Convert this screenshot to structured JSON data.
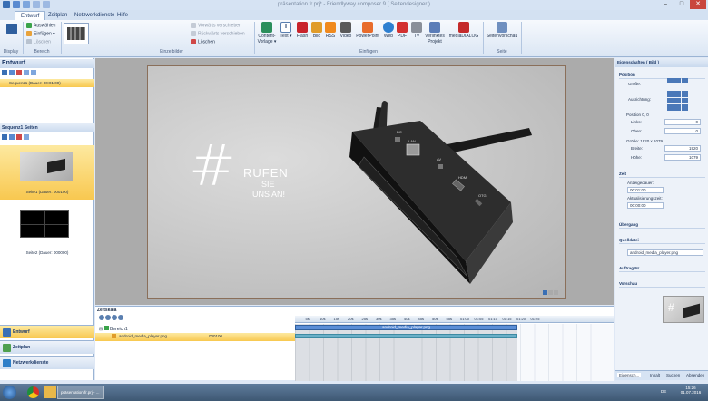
{
  "window": {
    "title": "präsentation.fr.prj* - Friendlyway composer 9 ( Seitendesigner )"
  },
  "tabs": [
    "Entwurf",
    "Zeitplan",
    "Netzwerkdienste",
    "Hilfe"
  ],
  "ribbon": {
    "display_label": "Display",
    "bereich": {
      "items": [
        "Auswählen",
        "Einfügen",
        "Löschen"
      ],
      "label": "Bereich"
    },
    "einzelbilder": {
      "items": [
        "Vorwärts verschieben",
        "Rückwärts verschieben",
        "Löschen"
      ],
      "label": "Einzelbilder"
    },
    "einfuegen": {
      "buttons": [
        "Content-Vorlage",
        "Text",
        "Flash",
        "Bild",
        "RSS",
        "Video",
        "PowerPoint",
        "Web",
        "PDF",
        "TV",
        "Verlinktes Projekt",
        "mediaDIALOG"
      ],
      "label": "Einfügen"
    },
    "seite": {
      "button": "Seitenvorschau",
      "label": "Seite"
    }
  },
  "left": {
    "entwurf_title": "Entwurf",
    "sequence_item": "Sequenz1 (Dauer: 00:01:00)",
    "pages_title": "Sequenz1 Seiten",
    "pages": [
      {
        "label": "Seite1 (Dauer: 000100)"
      },
      {
        "label": "Seite2 (Dauer: 000000)"
      }
    ],
    "nav": [
      "Entwurf",
      "Zeitplan",
      "Netzwerkdienste"
    ]
  },
  "canvas": {
    "hashtag": "#",
    "line1": "RUFEN",
    "line2": "SIE",
    "line3": "UNS AN!"
  },
  "device_labels": {
    "dc": "DC",
    "lan": "LAN",
    "av": "AV",
    "hdmi": "HDMI",
    "otg": "OTG"
  },
  "right": {
    "title": "Eigenschaften ( Bild )",
    "position": {
      "header": "Position",
      "groesse": "Größe:",
      "ausrichtung": "Ausrichtung:",
      "pos_text": "Position 0, 0",
      "links_label": "Links:",
      "links": "0",
      "oben_label": "Oben:",
      "oben": "0",
      "size_text": "Größe: 1920 x 1079",
      "breite_label": "Breite:",
      "breite": "1920",
      "hoehe_label": "Höhe:",
      "hoehe": "1079"
    },
    "zeit": {
      "header": "Zeit",
      "anzeige_label": "Anzeigedauer:",
      "anzeige": "00:01:00",
      "akt_label": "Aktualisierungszeit:",
      "akt": "00:00:00"
    },
    "uebergang": "Übergang",
    "quelldatei": {
      "header": "Quelldatei",
      "value": "android_media_player.png"
    },
    "aufrag": "Auftrag Nr",
    "vorschau": "Vorschau",
    "bottom_tabs": [
      "Eigensch...",
      "Inhalt",
      "Suchen",
      "Absenden"
    ]
  },
  "timeline": {
    "title": "Zeitskala",
    "ticks": [
      "5s",
      "10s",
      "15s",
      "20s",
      "25s",
      "30s",
      "35s",
      "40s",
      "45s",
      "50s",
      "55s",
      "01:00",
      "01:05",
      "01:10",
      "01:15",
      "01:20",
      "01:25"
    ],
    "bereich": "Bereich1",
    "item": "android_media_player.png",
    "item_time": "000100",
    "bar_label": "android_media_player.png"
  },
  "taskbar": {
    "app": "präsentation.fr.prj - ...",
    "time": "15:26",
    "date": "01.07.2016",
    "lang": "DE"
  }
}
